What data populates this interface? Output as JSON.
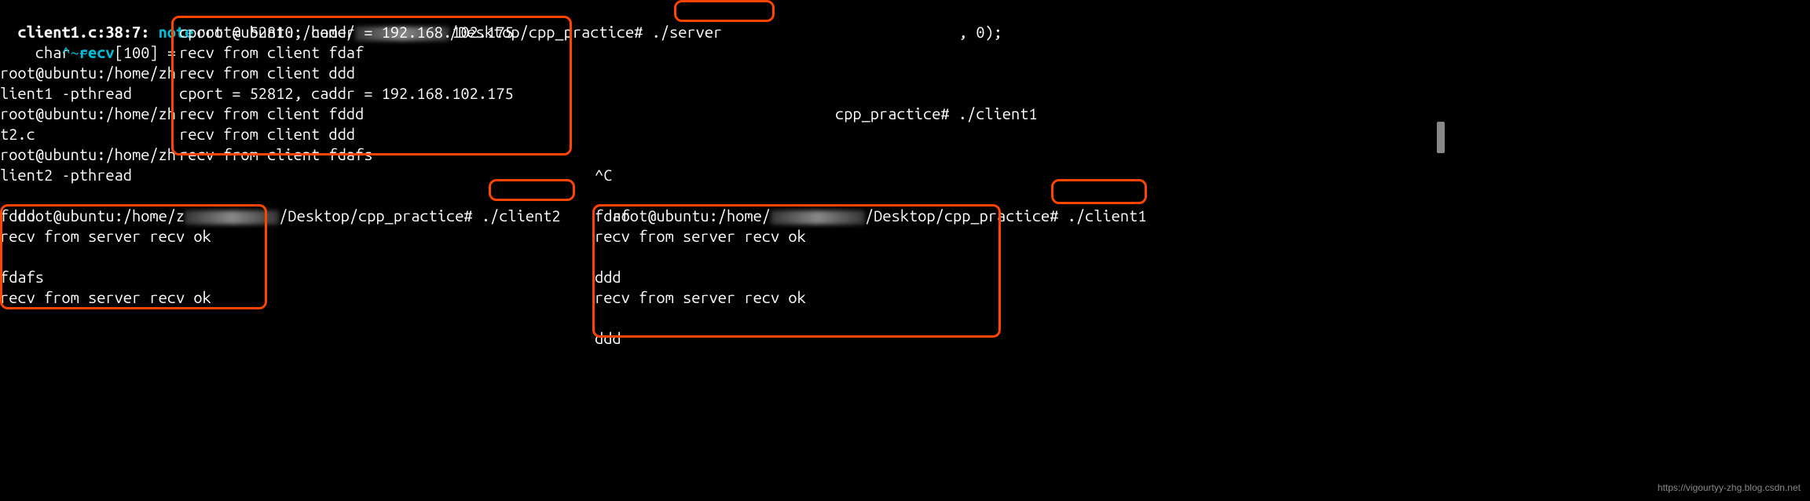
{
  "left_panel": {
    "line1_file": "client1.c:38:7: ",
    "line1_note": "note",
    "line2_pre": "  char ",
    "line2_recv": "recv",
    "line2_post": "[100] = ",
    "line3": "       ^~~~",
    "line4": "root@ubuntu:/home/zh",
    "line5": "lient1 -pthread",
    "line6": "root@ubuntu:/home/zh",
    "line7": "t2.c",
    "line8": "root@ubuntu:/home/zh",
    "line9": "lient2 -pthread",
    "line10_prompt": "root@ubuntu:/home/z",
    "line10_path": "/Desktop/cpp_practice# ",
    "line10_cmd": "./client2",
    "line11": "fddd",
    "line12": "recv from server recv ok",
    "line13": "",
    "line14": "fdafs",
    "line15": "recv from server recv ok"
  },
  "server_panel": {
    "line1_prompt": "root@ubuntu:/home/",
    "line1_path": "/Desktop/cpp_practice# ",
    "line1_cmd": "./server",
    "line1_tail": ", 0);",
    "line2": "cport = 52810, caddr = 192.168.102.175",
    "line3": "recv from client fdaf",
    "line4": "recv from client ddd",
    "line5": "cport = 52812, caddr = 192.168.102.175",
    "line6": "recv from client fddd",
    "line7": "recv from client ddd",
    "line8": "recv from client fdafs"
  },
  "right_panel": {
    "line1_path": "cpp_practice# ./client1",
    "line2": "^C",
    "line3_prompt": "root@ubuntu:/home/",
    "line3_path": "/Desktop/cpp_practice# ",
    "line3_cmd": "./client1",
    "line4": "fdaf",
    "line5": "recv from server recv ok",
    "line6": "",
    "line7": "ddd",
    "line8": "recv from server recv ok",
    "line9": "",
    "line10": "ddd"
  },
  "watermark": "https://vigourtyy-zhg.blog.csdn.net"
}
